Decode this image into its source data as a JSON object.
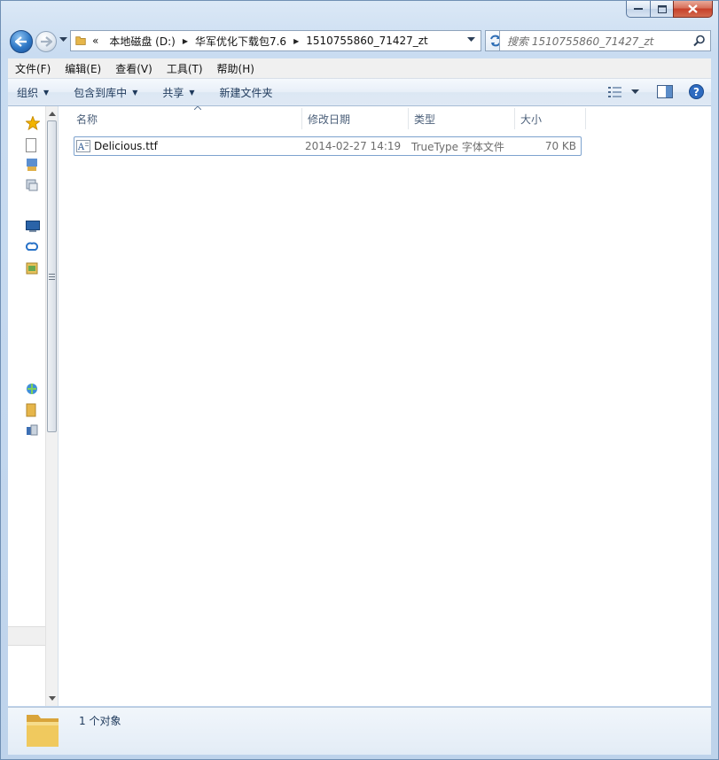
{
  "address": {
    "overflow_glyph": "«",
    "crumbs": [
      "本地磁盘 (D:)",
      "华军优化下载包7.6",
      "1510755860_71427_zt"
    ]
  },
  "search": {
    "placeholder": "搜索 1510755860_71427_zt"
  },
  "menu": [
    "文件(F)",
    "编辑(E)",
    "查看(V)",
    "工具(T)",
    "帮助(H)"
  ],
  "commands": {
    "organize": "组织",
    "include_library": "包含到库中",
    "share": "共享",
    "new_folder": "新建文件夹"
  },
  "columns": [
    "名称",
    "修改日期",
    "类型",
    "大小"
  ],
  "files": [
    {
      "name": "Delicious.ttf",
      "modified": "2014-02-27 14:19",
      "type": "TrueType 字体文件",
      "size": "70 KB"
    }
  ],
  "status": {
    "count": "1 个对象"
  },
  "colors": {
    "selection_border": "#7da2ce",
    "command_text": "#1e395b",
    "close_button": "#c7402a"
  }
}
